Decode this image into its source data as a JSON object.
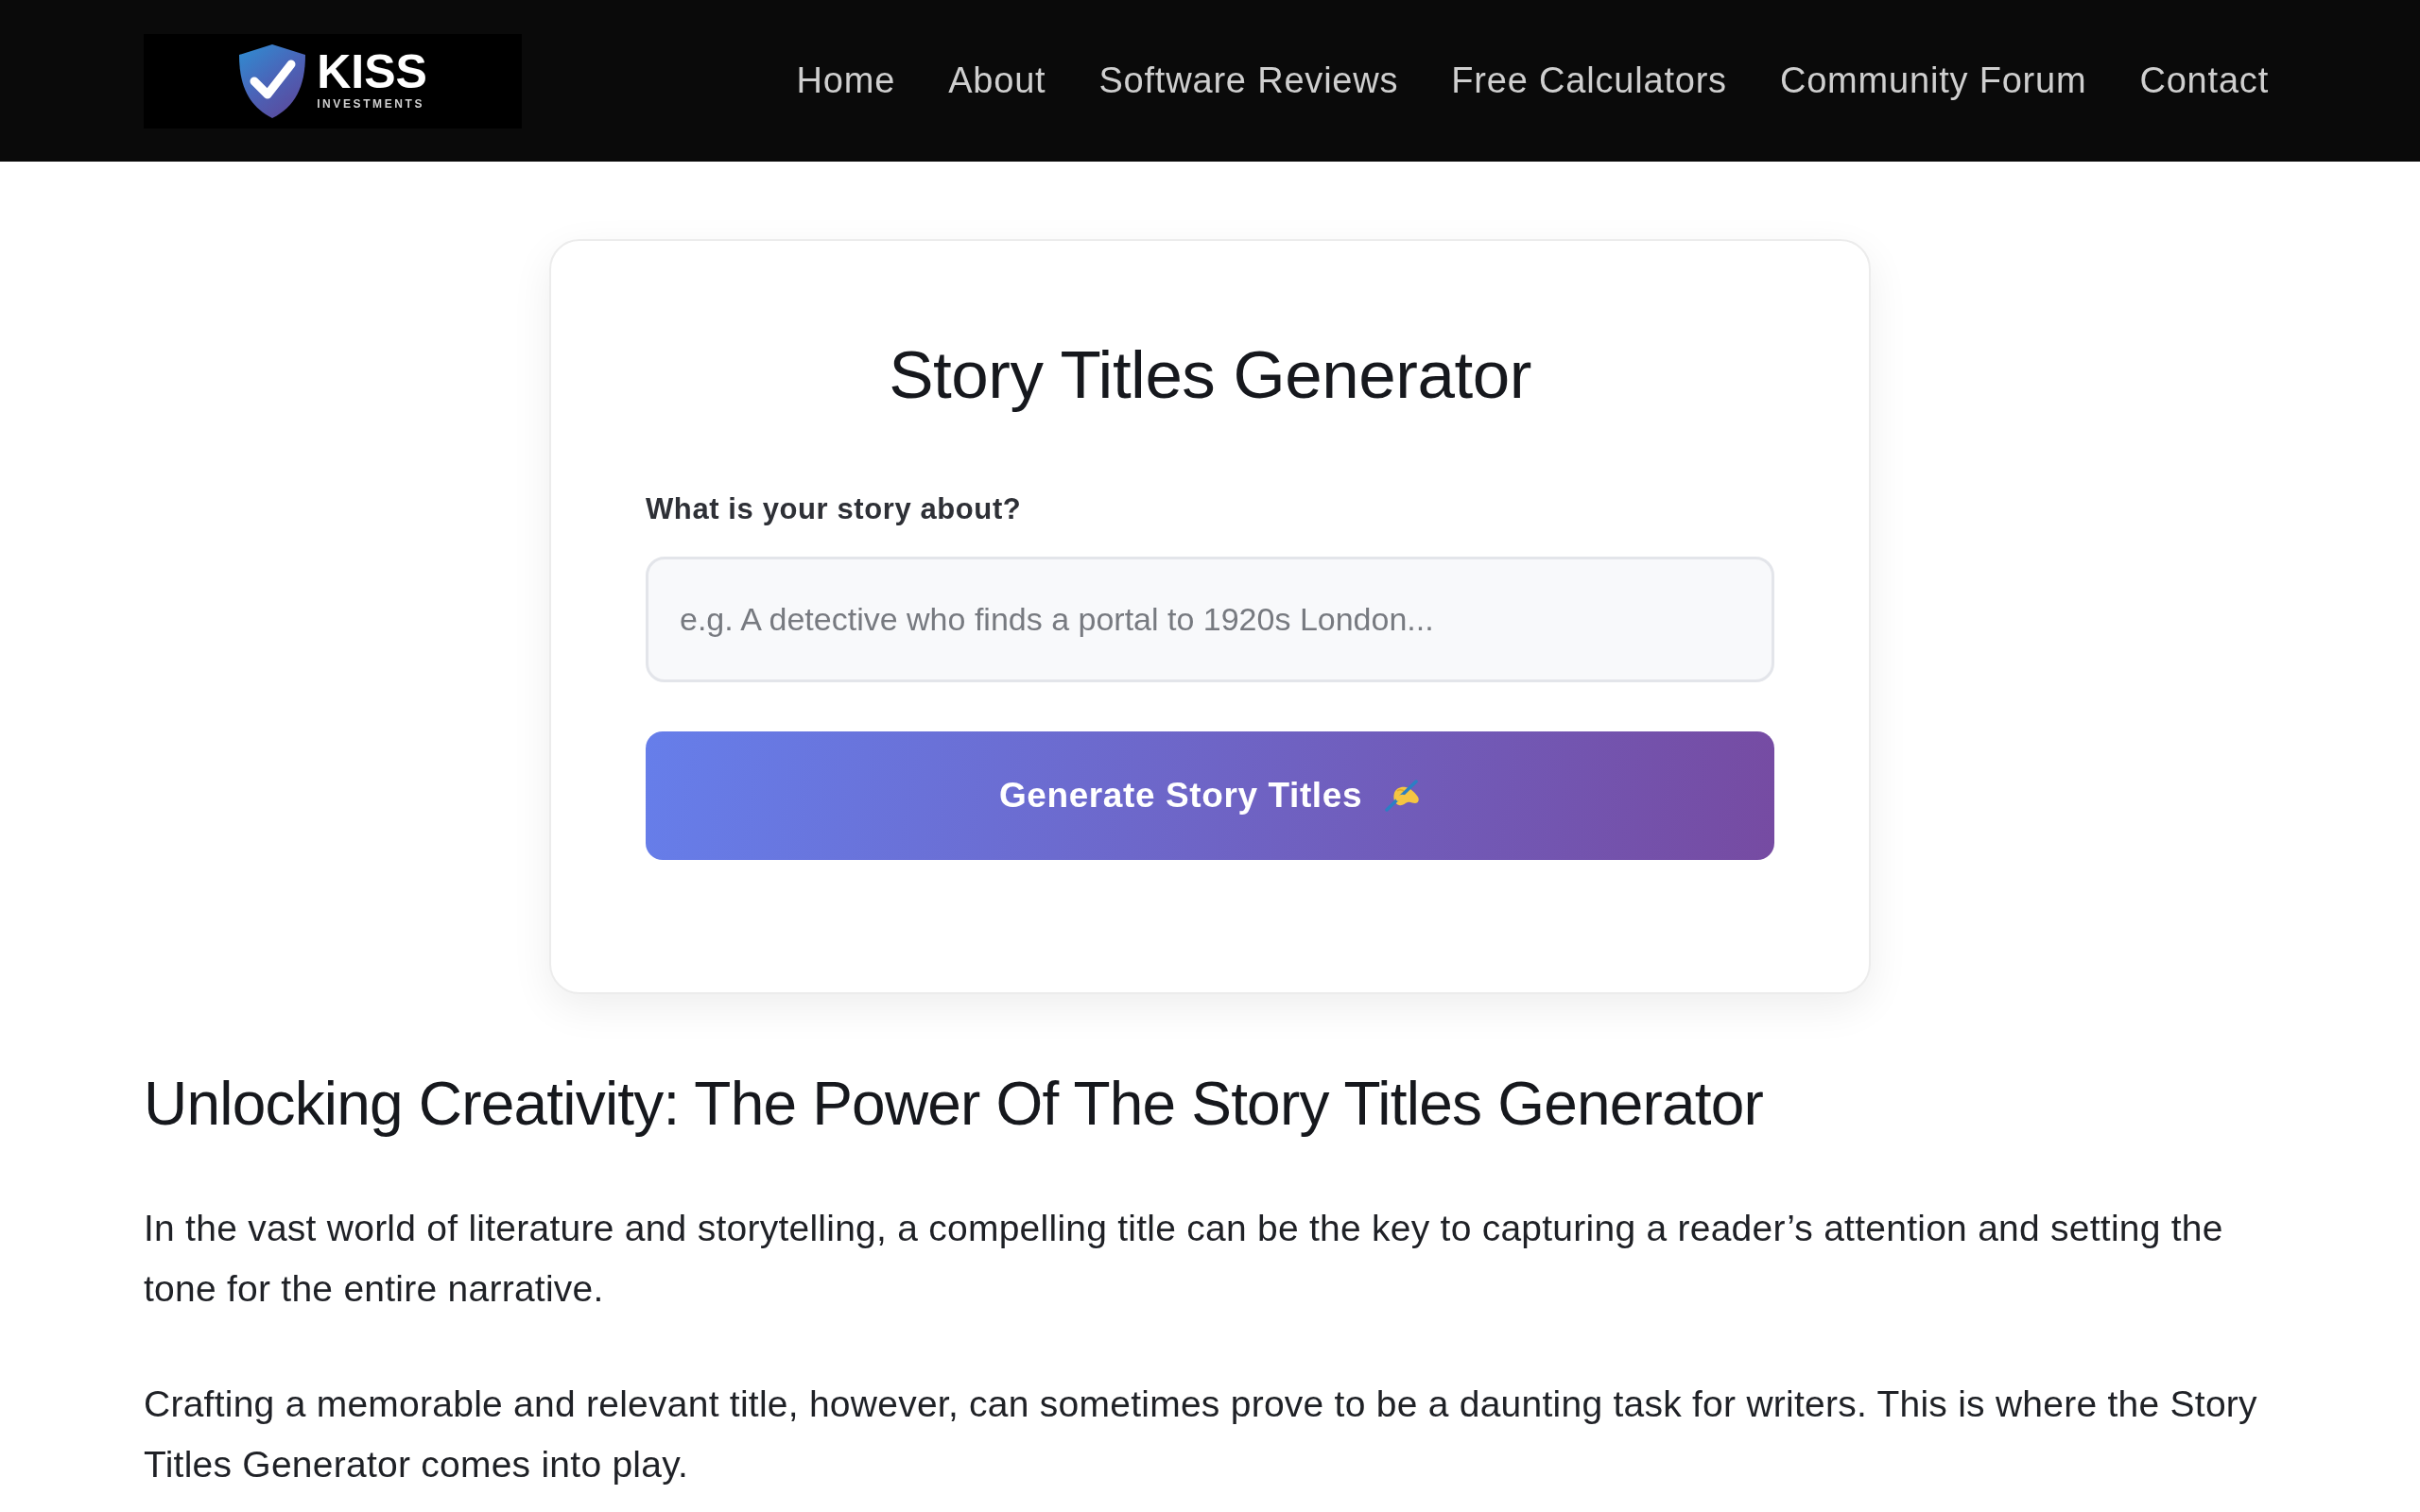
{
  "header": {
    "logo": {
      "name": "KISS",
      "tagline": "INVESTMENTS"
    },
    "nav": [
      {
        "label": "Home"
      },
      {
        "label": "About"
      },
      {
        "label": "Software Reviews"
      },
      {
        "label": "Free Calculators"
      },
      {
        "label": "Community Forum"
      },
      {
        "label": "Contact"
      }
    ]
  },
  "generator": {
    "title": "Story Titles Generator",
    "field_label": "What is your story about?",
    "input": {
      "placeholder": "e.g. A detective who finds a portal to 1920s London..."
    },
    "button": {
      "label": "Generate Story Titles"
    }
  },
  "article": {
    "heading": "Unlocking Creativity: The Power Of The Story Titles Generator",
    "paragraphs": [
      "In the vast world of literature and storytelling, a compelling title can be the key to capturing a reader’s attention and setting the tone for the entire narrative.",
      "Crafting a memorable and relevant title, however, can sometimes prove to be a daunting task for writers. This is where the Story Titles Generator comes into play."
    ]
  }
}
